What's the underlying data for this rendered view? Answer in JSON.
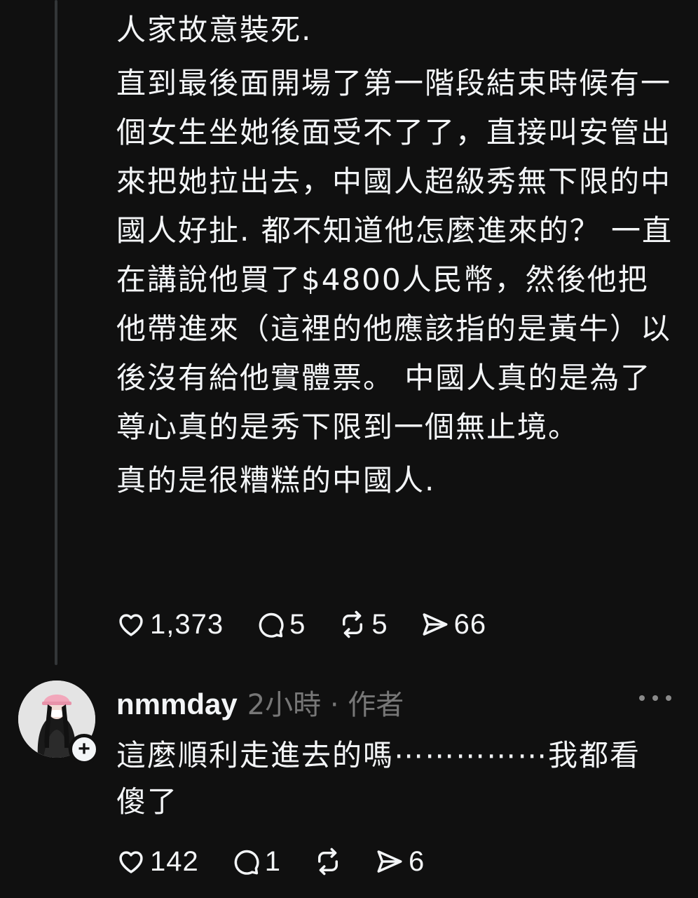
{
  "post": {
    "paragraphs": [
      "人家故意裝死.",
      "直到最後面開場了第一階段結束時候有一個女生坐她後面受不了了，直接叫安管出來把她拉出去，中國人超級秀無下限的中國人好扯. 都不知道他怎麼進來的？ 一直在講說他買了$4800人民幣，然後他把他帶進來（這裡的他應該指的是黃牛）以後沒有給他實體票。 中國人真的是為了尊心真的是秀下限到一個無止境。",
      "真的是很糟糕的中國人."
    ],
    "actions": {
      "likes": "1,373",
      "comments": "5",
      "reposts": "5",
      "shares": "66",
      "icons": [
        "heart-icon",
        "comment-icon",
        "repost-icon",
        "share-icon"
      ]
    }
  },
  "reply": {
    "username": "nmmday",
    "meta": "2小時 · 作者",
    "text": "這麼順利走進去的嗎⋯⋯⋯⋯⋯我都看傻了",
    "actions": {
      "likes": "142",
      "comments": "1",
      "shares": "6"
    },
    "follow_icon": "plus-icon",
    "more_icon": "more-icon"
  },
  "colors": {
    "background": "#101010",
    "text": "#f3f5f7",
    "secondary": "#777777",
    "thread_line": "#333638"
  }
}
